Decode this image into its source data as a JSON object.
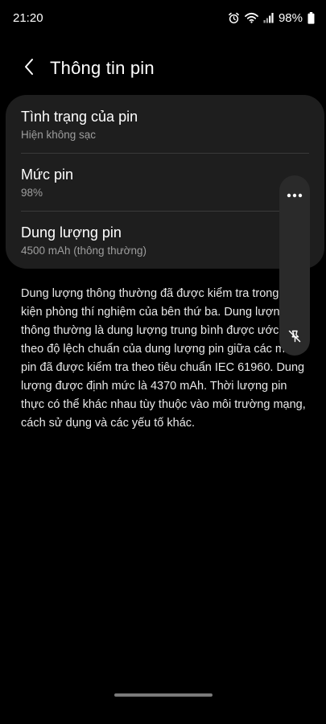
{
  "status_bar": {
    "time": "21:20",
    "battery_percent": "98%",
    "icons": [
      "alarm-icon",
      "wifi-icon",
      "signal-icon",
      "battery-icon"
    ]
  },
  "header": {
    "title": "Thông tin pin",
    "back_icon": "chevron-left-icon"
  },
  "battery_info": {
    "items": [
      {
        "title": "Tình trạng của pin",
        "subtitle": "Hiện không sạc"
      },
      {
        "title": "Mức pin",
        "subtitle": "98%"
      },
      {
        "title": "Dung lượng pin",
        "subtitle": "4500 mAh (thông thường)"
      }
    ]
  },
  "description": {
    "lines": [
      "Dung lượng thông thường đã được kiểm tra trong",
      "kiện phòng thí nghiệm của bên thứ ba. Dung lượng",
      "thông thường là dung lượng trung bình được ước t",
      "theo độ lệch chuẩn của dung lượng pin giữa các m",
      "pin đã được kiểm tra theo tiêu chuẩn IEC 61960. Dung",
      "lượng được định mức là 4370 mAh. Thời lượng pin",
      "thực có thể khác nhau tùy thuộc vào môi trường mạng,",
      "cách sử dụng và các yếu tố khác."
    ]
  },
  "floating_panel": {
    "icons": [
      "more-options-icon",
      "unpin-icon"
    ]
  },
  "colors": {
    "background": "#000000",
    "card": "#1e1e1e",
    "divider": "#3a3a3a",
    "subtitle": "#9e9e9e",
    "floating_panel": "#2a2a2a"
  }
}
